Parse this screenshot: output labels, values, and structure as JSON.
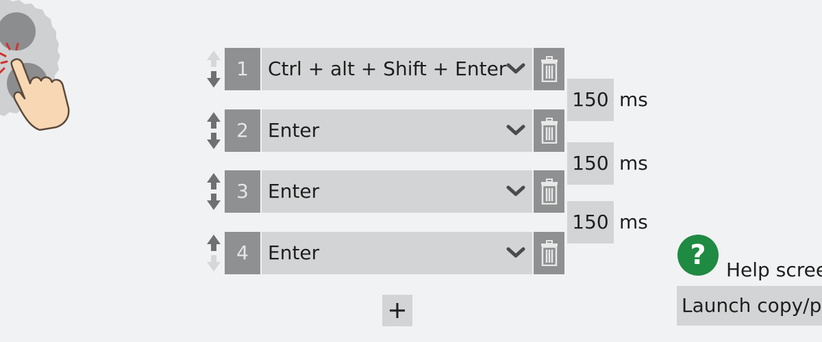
{
  "steps": [
    {
      "number": "1",
      "key": "Ctrl + alt + Shift + Enter",
      "up_enabled": false,
      "down_enabled": true
    },
    {
      "number": "2",
      "key": "Enter",
      "up_enabled": true,
      "down_enabled": true
    },
    {
      "number": "3",
      "key": "Enter",
      "up_enabled": true,
      "down_enabled": true
    },
    {
      "number": "4",
      "key": "Enter",
      "up_enabled": true,
      "down_enabled": false
    }
  ],
  "delays": [
    {
      "value": "150",
      "unit": "ms"
    },
    {
      "value": "150",
      "unit": "ms"
    },
    {
      "value": "150",
      "unit": "ms"
    }
  ],
  "add_button": {
    "icon": "plus-icon"
  },
  "help": {
    "icon_glyph": "?",
    "label": "Help screen"
  },
  "launch": {
    "label": "Launch copy/paste"
  },
  "colors": {
    "background": "#f1f2f3",
    "dark_gray": "#8f9091",
    "light_gray": "#d3d4d5",
    "help_green": "#1f8a42",
    "touch_accent": "#d4302c"
  }
}
